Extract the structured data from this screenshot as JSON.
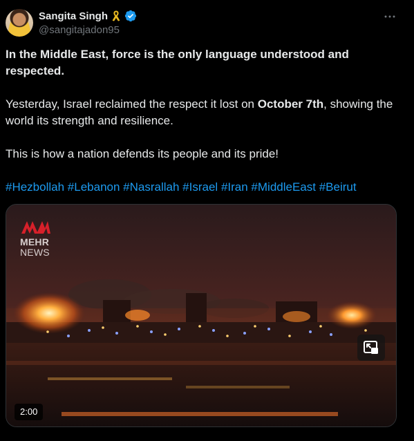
{
  "author": {
    "display_name": "Sangita Singh",
    "handle": "@sangitajadon95",
    "badges": [
      "ribbon-icon",
      "verified-icon"
    ],
    "verified_color": "#1d9bf0"
  },
  "tweet": {
    "lead": "In the Middle East, force is the only language understood and respected.",
    "p2_before": "Yesterday, Israel reclaimed the respect it lost on ",
    "p2_bold": "October 7th",
    "p2_after": ", showing the world its strength and resilience.",
    "p3": "This is how a nation defends its people and its pride!",
    "hashtags": [
      "#Hezbollah",
      "#Lebanon",
      "#Nasrallah",
      "#Israel",
      "#Iran",
      "#MiddleEast",
      "#Beirut"
    ],
    "hashtag_color": "#1d9bf0"
  },
  "media": {
    "watermark_line1": "MEHR",
    "watermark_line2": "NEWS",
    "duration": "2:00",
    "pip_icon": "picture-in-picture-icon"
  },
  "menu_icon": "more-icon"
}
